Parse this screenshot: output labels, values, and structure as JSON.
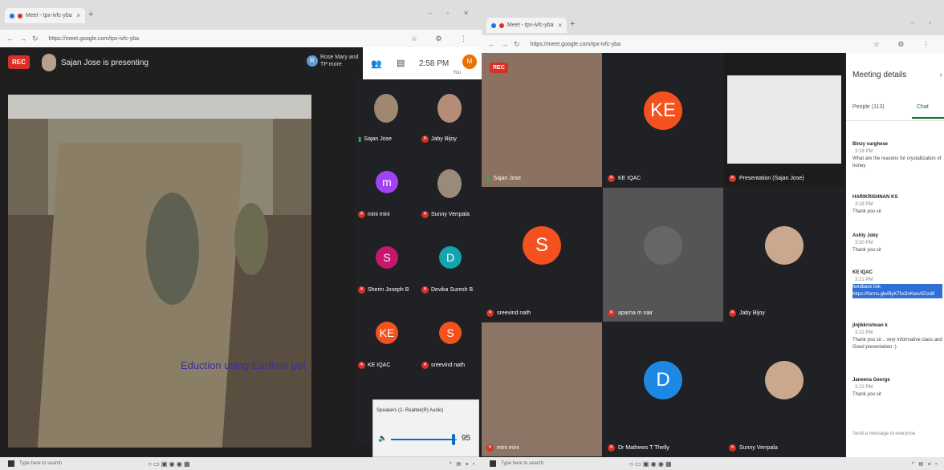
{
  "left": {
    "tab_title": "Meet - tpx-ivfc-yba",
    "url": "https://meet.google.com/tpx-ivfc-yba",
    "rec": "REC",
    "presenting": "Sajan Jose is presenting",
    "remote_initial": "R",
    "remote_name": "Rose Mary and TP more",
    "time": "2:58 PM",
    "you": "You",
    "me_initial": "M",
    "caption": "Eduction using Earthen pot",
    "tiles": [
      {
        "name": "Sajan Jose",
        "initial": "",
        "color": "#a08870",
        "mic": "on"
      },
      {
        "name": "Jaby Bijoy",
        "initial": "",
        "color": "#b48c78",
        "mic": "off"
      },
      {
        "name": "mini mini",
        "initial": "m",
        "color": "#a142f4",
        "mic": "off"
      },
      {
        "name": "Sunny Verrpala",
        "initial": "",
        "color": "#9a8a7a",
        "mic": "off"
      },
      {
        "name": "Sherin Joseph B",
        "initial": "S",
        "color": "#c5186d",
        "mic": "off"
      },
      {
        "name": "Devika Suresh B",
        "initial": "D",
        "color": "#12a4af",
        "mic": "off"
      },
      {
        "name": "KE IQAC",
        "initial": "KE",
        "color": "#f4511e",
        "mic": "off"
      },
      {
        "name": "sreevind nath",
        "initial": "S",
        "color": "#f4511e",
        "mic": "off"
      }
    ],
    "speaker": {
      "title": "Speakers (2- Realtek(R) Audio)",
      "value": "95",
      "level": 0.95
    },
    "taskbar_search": "Type here to search"
  },
  "right": {
    "tab_title": "Meet - tpx-ivfc-yba",
    "url": "https://meet.google.com/tpx-ivfc-yba",
    "rec": "REC",
    "tiles": [
      {
        "name": "Sajan Jose",
        "initial": "",
        "color": "",
        "mic": "on"
      },
      {
        "name": "KE IQAC",
        "initial": "KE",
        "color": "#f4511e",
        "mic": "off"
      },
      {
        "name": "Presentation (Sajan Jose)",
        "initial": "",
        "color": "",
        "mic": "off"
      },
      {
        "name": "sreevind nath",
        "initial": "S",
        "color": "#f4511e",
        "mic": "off"
      },
      {
        "name": "aparna m nair",
        "initial": "",
        "color": "",
        "mic": "off"
      },
      {
        "name": "Jaby Bijoy",
        "initial": "",
        "color": "",
        "mic": "off"
      },
      {
        "name": "mini mini",
        "initial": "",
        "color": "",
        "mic": "off"
      },
      {
        "name": "Dr Mathews T Thelly",
        "initial": "D",
        "color": "#1e88e5",
        "mic": "off"
      },
      {
        "name": "Sunny Verrpala",
        "initial": "",
        "color": "",
        "mic": "off"
      }
    ],
    "details": {
      "title": "Meeting details",
      "people_tab": "People (113)",
      "chat_tab": "Chat",
      "messages": [
        {
          "who": "Binzy varghese",
          "time": "3:18 PM",
          "text": "What are the reasons for crystallization of honey"
        },
        {
          "who": "HARIKRISHNAN KS",
          "time": "3:18 PM",
          "text": "Thank you sir"
        },
        {
          "who": "Ashly Joby",
          "time": "3:20 PM",
          "text": "Thank you sir"
        },
        {
          "who": "KE IQAC",
          "time": "3:21 PM",
          "text": "feedback link",
          "link": "https://forms.gle/ByK7hx3nKwvAEtzd9"
        },
        {
          "who": "jinjikkrishnan k",
          "time": "3:22 PM",
          "text": "Thank you sir... very informative class and Good presentation :)"
        },
        {
          "who": "Janeena George",
          "time": "3:22 PM",
          "text": "Thank you sir"
        }
      ],
      "send_placeholder": "Send a message to everyone"
    },
    "taskbar_search": "Type here to search"
  }
}
